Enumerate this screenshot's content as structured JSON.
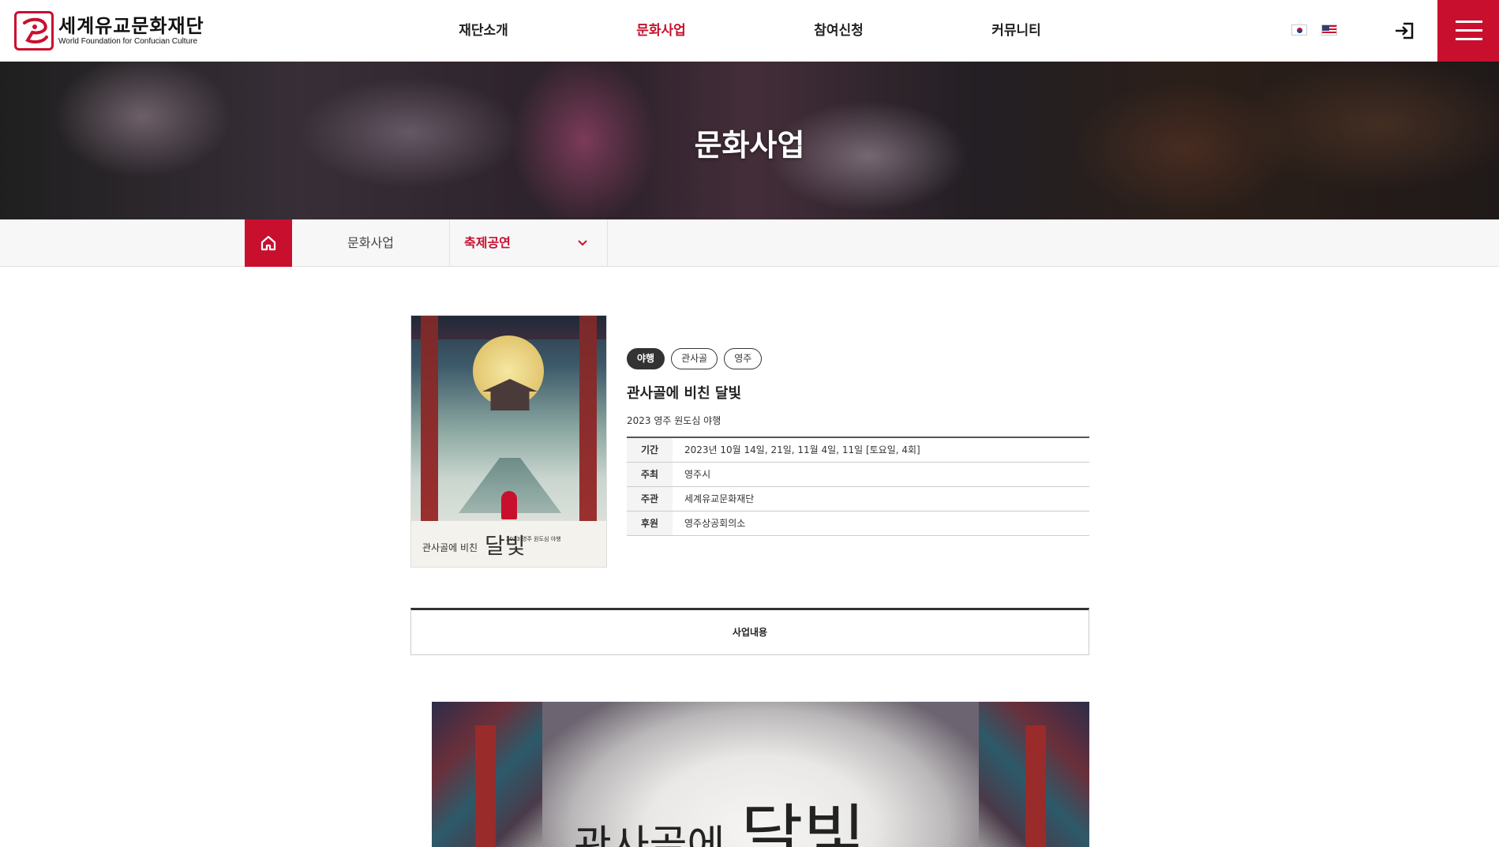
{
  "logo": {
    "name_ko": "세계유교문화재단",
    "name_en": "World Foundation for Confucian Culture"
  },
  "gnb": [
    {
      "label": "재단소개",
      "active": false
    },
    {
      "label": "문화사업",
      "active": true
    },
    {
      "label": "참여신청",
      "active": false
    },
    {
      "label": "커뮤니티",
      "active": false
    }
  ],
  "header_icons": {
    "lang_ko": "korea-flag-icon",
    "lang_en": "usa-flag-icon",
    "login": "login-icon",
    "menu": "hamburger-menu-icon"
  },
  "visual": {
    "title": "문화사업"
  },
  "subnav": {
    "home_icon": "home-icon",
    "depth1": "문화사업",
    "depth2": "축제공연"
  },
  "event": {
    "tags": [
      "야행",
      "관사골",
      "영주"
    ],
    "title": "관사골에 비친 달빛",
    "subtitle": "2023 영주 원도심 야행",
    "info": [
      {
        "label": "기간",
        "value": "2023년 10월 14일, 21일, 11월 4일, 11일 [토요일, 4회]"
      },
      {
        "label": "주최",
        "value": "영주시"
      },
      {
        "label": "주관",
        "value": "세계유교문화재단"
      },
      {
        "label": "후원",
        "value": "영주상공회의소"
      }
    ],
    "poster": {
      "title_small": "관사골에 비친",
      "title_large": "달빛",
      "caption": "2023 영주 원도심 야행"
    }
  },
  "tab": {
    "label": "사업내용"
  },
  "detail_image": {
    "text_small": "관사골에",
    "text_large": "달빛"
  },
  "colors": {
    "brand_red": "#c8102e",
    "dark": "#333333"
  }
}
